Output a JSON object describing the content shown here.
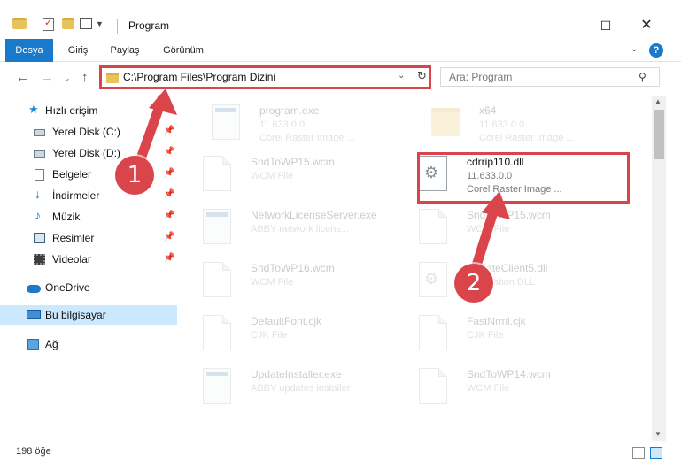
{
  "window": {
    "title": "Program",
    "minimize_glyph": "—",
    "maximize_glyph": "☐",
    "close_glyph": "✕"
  },
  "ribbon": {
    "tabs": [
      "Dosya",
      "Giriş",
      "Paylaş",
      "Görünüm"
    ],
    "expand_glyph": "⌄",
    "help_glyph": "?"
  },
  "nav": {
    "back_glyph": "←",
    "forward_glyph": "→",
    "history_glyph": "⌄",
    "up_glyph": "↑",
    "address": "C:\\Program Files\\Program Dizini",
    "address_dropdown_glyph": "⌄",
    "refresh_glyph": "↻",
    "search_placeholder": "Ara: Program",
    "search_glyph": "⚲"
  },
  "sidebar": {
    "items": [
      {
        "label": "Hızlı erişim",
        "icon": "star-icon",
        "pinned": false
      },
      {
        "label": "Yerel Disk (C:)",
        "icon": "drive-icon",
        "pinned": true
      },
      {
        "label": "Yerel Disk (D:)",
        "icon": "drive-icon",
        "pinned": true
      },
      {
        "label": "Belgeler",
        "icon": "document-icon",
        "pinned": true
      },
      {
        "label": "İndirmeler",
        "icon": "download-icon",
        "pinned": true
      },
      {
        "label": "Müzik",
        "icon": "music-icon",
        "pinned": true
      },
      {
        "label": "Resimler",
        "icon": "picture-icon",
        "pinned": true
      },
      {
        "label": "Videolar",
        "icon": "video-icon",
        "pinned": true
      },
      {
        "label": "OneDrive",
        "icon": "cloud-icon",
        "pinned": false
      },
      {
        "label": "Bu bilgisayar",
        "icon": "computer-icon",
        "pinned": false,
        "selected": true
      },
      {
        "label": "Ağ",
        "icon": "network-icon",
        "pinned": false
      }
    ],
    "pin_glyph": "📌",
    "star_glyph": "★",
    "download_glyph": "↓",
    "music_glyph": "♪"
  },
  "files": [
    {
      "name": "program.exe",
      "meta1": "11.633.0.0",
      "meta2": "Corel Raster Image ...",
      "icon": "exe-icon",
      "faded": true
    },
    {
      "name": "x64",
      "meta1": "11.633.0.0",
      "meta2": "Corel Raster Image ...",
      "icon": "folder-icon",
      "faded": true
    },
    {
      "name": "SndToWP15.wcm",
      "meta1": "WCM File",
      "meta2": "",
      "icon": "document-icon",
      "faded": true
    },
    {
      "name": "cdrrip110.dll",
      "meta1": "11.633.0.0",
      "meta2": "Corel Raster Image ...",
      "icon": "gear-icon",
      "faded": false,
      "highlighted": true
    },
    {
      "name": "NetworkLicenseServer.exe",
      "meta1": "ABBY network licens...",
      "meta2": "",
      "icon": "exe-icon",
      "faded": true
    },
    {
      "name": "SndToWP15.wcm",
      "meta1": "WCM File",
      "meta2": "",
      "icon": "document-icon",
      "faded": true
    },
    {
      "name": "SndToWP16.wcm",
      "meta1": "WCM File",
      "meta2": "",
      "icon": "document-icon",
      "faded": true
    },
    {
      "name": "UpdateClient5.dll",
      "meta1": "Application DLL",
      "meta2": "",
      "icon": "gear-icon",
      "faded": true
    },
    {
      "name": "DefaultFont.cjk",
      "meta1": "CJK File",
      "meta2": "",
      "icon": "document-icon",
      "faded": true
    },
    {
      "name": "FastNrml.cjk",
      "meta1": "CJK File",
      "meta2": "",
      "icon": "document-icon",
      "faded": true
    },
    {
      "name": "UpdateInstaller.exe",
      "meta1": "ABBY updates installer",
      "meta2": "",
      "icon": "exe-icon",
      "faded": true
    },
    {
      "name": "SndToWP14.wcm",
      "meta1": "WCM File",
      "meta2": "",
      "icon": "document-icon",
      "faded": true
    }
  ],
  "status": {
    "item_count": "198 öğe"
  },
  "annotations": {
    "step1": "1",
    "step2": "2",
    "color": "#d9454a"
  },
  "colors": {
    "accent": "#1979ca",
    "selection": "#cce8ff",
    "annotation_red": "#d9454a"
  }
}
